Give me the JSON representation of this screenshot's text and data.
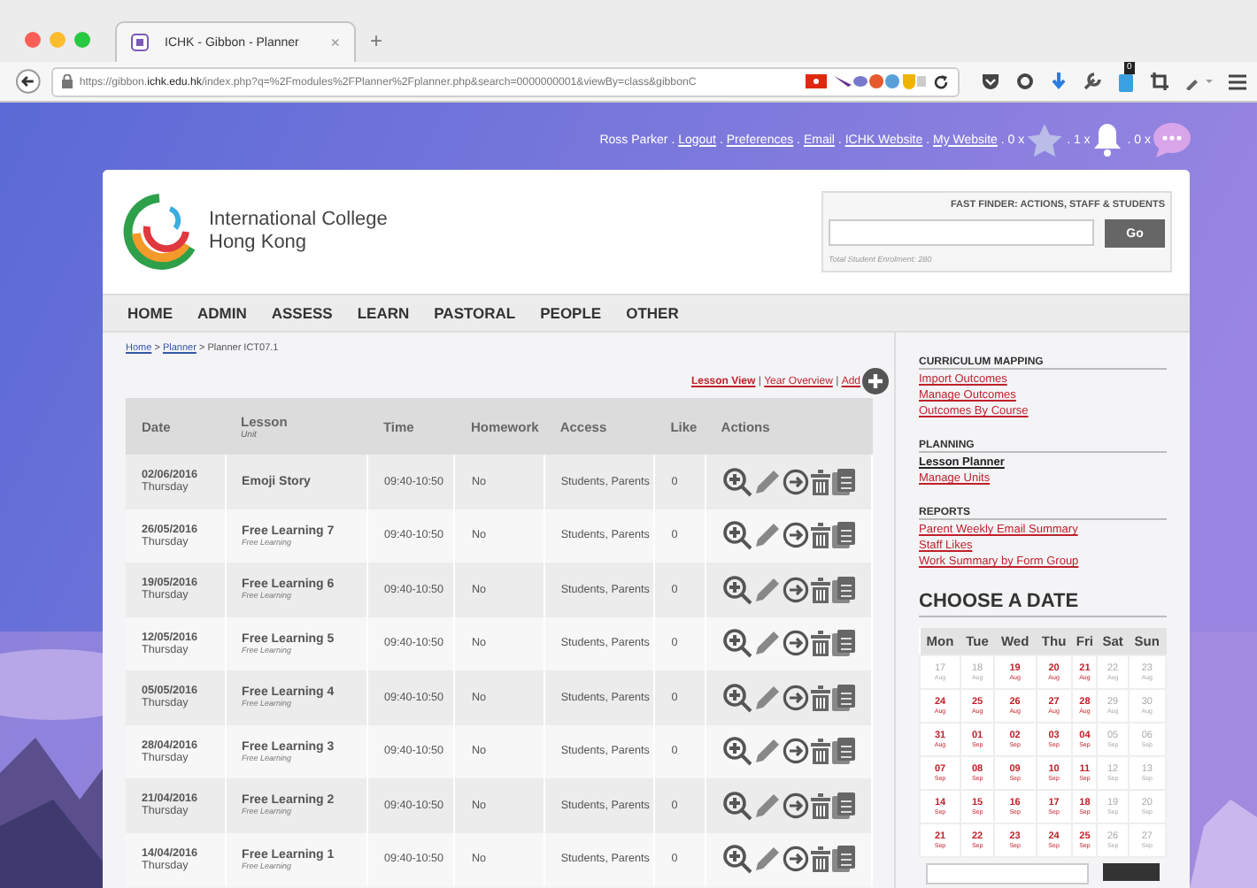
{
  "browser": {
    "tab_title": "ICHK - Gibbon - Planner",
    "tab_close": "×",
    "new_tab": "+",
    "url": "https://gibbon.**ichk.edu.hk**/index.php?q=%2Fmodules%2FPlanner%2Fplanner.php&search=0000000001&viewBy=class&gibbonC",
    "badge": "0"
  },
  "user_bar": [
    {
      "kind": "text",
      "text": "Ross Parker"
    },
    {
      "kind": "text",
      "text": " . "
    },
    {
      "kind": "link",
      "text": "Logout"
    },
    {
      "kind": "text",
      "text": " . "
    },
    {
      "kind": "link",
      "text": "Preferences"
    },
    {
      "kind": "text",
      "text": " . "
    },
    {
      "kind": "link",
      "text": "Email"
    },
    {
      "kind": "text",
      "text": " . "
    },
    {
      "kind": "link",
      "text": "ICHK Website"
    },
    {
      "kind": "text",
      "text": " . "
    },
    {
      "kind": "link",
      "text": "My Website"
    },
    {
      "kind": "text",
      "text": " . 0 x"
    },
    {
      "kind": "star"
    },
    {
      "kind": "text",
      "text": " . 1 x"
    },
    {
      "kind": "bell"
    },
    {
      "kind": "text",
      "text": " . 0 x"
    },
    {
      "kind": "chat"
    }
  ],
  "school": {
    "name_line_1": "International College",
    "name_line_2": "Hong Kong"
  },
  "fast_finder": {
    "title": "FAST FINDER: ACTIONS, STAFF & STUDENTS",
    "button": "Go",
    "note": "Total Student Enrolment: 280"
  },
  "nav": [
    "HOME",
    "ADMIN",
    "ASSESS",
    "LEARN",
    "PASTORAL",
    "PEOPLE",
    "OTHER"
  ],
  "breadcrumb": [
    {
      "kind": "link",
      "text": "Home"
    },
    {
      "kind": "text",
      "text": " > "
    },
    {
      "kind": "link",
      "text": "Planner"
    },
    {
      "kind": "text",
      "text": " > Planner ICT07.1"
    }
  ],
  "view_links": [
    {
      "text": "Lesson View",
      "selected": true
    },
    {
      "text": "Year Overview",
      "selected": false
    },
    {
      "text": "Add",
      "selected": false
    }
  ],
  "view_separator": " | ",
  "table": {
    "columns": [
      {
        "label": "Date"
      },
      {
        "label": "Lesson",
        "sub": "Unit"
      },
      {
        "label": "Time"
      },
      {
        "label": "Homework"
      },
      {
        "label": "Access"
      },
      {
        "label": "Like"
      },
      {
        "label": "Actions"
      }
    ],
    "rows": [
      {
        "date": "02/06/2016",
        "day": "Thursday",
        "lesson": "Emoji Story",
        "time": "09:40-10:50",
        "homework": "No",
        "access": "Students, Parents",
        "like": "0"
      },
      {
        "date": "26/05/2016",
        "day": "Thursday",
        "lesson": "Free Learning 7",
        "unit": "Free Learning",
        "time": "09:40-10:50",
        "homework": "No",
        "access": "Students, Parents",
        "like": "0"
      },
      {
        "date": "19/05/2016",
        "day": "Thursday",
        "lesson": "Free Learning 6",
        "unit": "Free Learning",
        "time": "09:40-10:50",
        "homework": "No",
        "access": "Students, Parents",
        "like": "0"
      },
      {
        "date": "12/05/2016",
        "day": "Thursday",
        "lesson": "Free Learning 5",
        "unit": "Free Learning",
        "time": "09:40-10:50",
        "homework": "No",
        "access": "Students, Parents",
        "like": "0"
      },
      {
        "date": "05/05/2016",
        "day": "Thursday",
        "lesson": "Free Learning 4",
        "unit": "Free Learning",
        "time": "09:40-10:50",
        "homework": "No",
        "access": "Students, Parents",
        "like": "0"
      },
      {
        "date": "28/04/2016",
        "day": "Thursday",
        "lesson": "Free Learning 3",
        "unit": "Free Learning",
        "time": "09:40-10:50",
        "homework": "No",
        "access": "Students, Parents",
        "like": "0"
      },
      {
        "date": "21/04/2016",
        "day": "Thursday",
        "lesson": "Free Learning 2",
        "unit": "Free Learning",
        "time": "09:40-10:50",
        "homework": "No",
        "access": "Students, Parents",
        "like": "0"
      },
      {
        "date": "14/04/2016",
        "day": "Thursday",
        "lesson": "Free Learning 1",
        "unit": "Free Learning",
        "time": "09:40-10:50",
        "homework": "No",
        "access": "Students, Parents",
        "like": "0"
      }
    ]
  },
  "sidebar": [
    {
      "title": "CURRICULUM MAPPING",
      "links": [
        {
          "text": "Import Outcomes",
          "selected": false
        },
        {
          "text": "Manage Outcomes",
          "selected": false
        },
        {
          "text": "Outcomes By Course",
          "selected": false
        }
      ]
    },
    {
      "title": "PLANNING",
      "links": [
        {
          "text": "Lesson Planner",
          "selected": true
        },
        {
          "text": "Manage Units",
          "selected": false
        }
      ]
    },
    {
      "title": "REPORTS",
      "links": [
        {
          "text": "Parent Weekly Email Summary",
          "selected": false
        },
        {
          "text": "Staff Likes",
          "selected": false
        },
        {
          "text": "Work Summary by Form Group",
          "selected": false
        }
      ]
    }
  ],
  "calendar": {
    "title": "CHOOSE A DATE",
    "weekdays": [
      "Mon",
      "Tue",
      "Wed",
      "Thu",
      "Fri",
      "Sat",
      "Sun"
    ],
    "weeks": [
      [
        {
          "day": "17",
          "month": "Aug",
          "active": false
        },
        {
          "day": "18",
          "month": "Aug",
          "active": false
        },
        {
          "day": "19",
          "month": "Aug",
          "active": true
        },
        {
          "day": "20",
          "month": "Aug",
          "active": true
        },
        {
          "day": "21",
          "month": "Aug",
          "active": true
        },
        {
          "day": "22",
          "month": "Aug",
          "active": false
        },
        {
          "day": "23",
          "month": "Aug",
          "active": false
        }
      ],
      [
        {
          "day": "24",
          "month": "Aug",
          "active": true
        },
        {
          "day": "25",
          "month": "Aug",
          "active": true
        },
        {
          "day": "26",
          "month": "Aug",
          "active": true
        },
        {
          "day": "27",
          "month": "Aug",
          "active": true
        },
        {
          "day": "28",
          "month": "Aug",
          "active": true
        },
        {
          "day": "29",
          "month": "Aug",
          "active": false
        },
        {
          "day": "30",
          "month": "Aug",
          "active": false
        }
      ],
      [
        {
          "day": "31",
          "month": "Aug",
          "active": true
        },
        {
          "day": "01",
          "month": "Sep",
          "active": true
        },
        {
          "day": "02",
          "month": "Sep",
          "active": true
        },
        {
          "day": "03",
          "month": "Sep",
          "active": true
        },
        {
          "day": "04",
          "month": "Sep",
          "active": true
        },
        {
          "day": "05",
          "month": "Sep",
          "active": false
        },
        {
          "day": "06",
          "month": "Sep",
          "active": false
        }
      ],
      [
        {
          "day": "07",
          "month": "Sep",
          "active": true
        },
        {
          "day": "08",
          "month": "Sep",
          "active": true
        },
        {
          "day": "09",
          "month": "Sep",
          "active": true
        },
        {
          "day": "10",
          "month": "Sep",
          "active": true
        },
        {
          "day": "11",
          "month": "Sep",
          "active": true
        },
        {
          "day": "12",
          "month": "Sep",
          "active": false
        },
        {
          "day": "13",
          "month": "Sep",
          "active": false
        }
      ],
      [
        {
          "day": "14",
          "month": "Sep",
          "active": true
        },
        {
          "day": "15",
          "month": "Sep",
          "active": true
        },
        {
          "day": "16",
          "month": "Sep",
          "active": true
        },
        {
          "day": "17",
          "month": "Sep",
          "active": true
        },
        {
          "day": "18",
          "month": "Sep",
          "active": true
        },
        {
          "day": "19",
          "month": "Sep",
          "active": false
        },
        {
          "day": "20",
          "month": "Sep",
          "active": false
        }
      ],
      [
        {
          "day": "21",
          "month": "Sep",
          "active": true
        },
        {
          "day": "22",
          "month": "Sep",
          "active": true
        },
        {
          "day": "23",
          "month": "Sep",
          "active": true
        },
        {
          "day": "24",
          "month": "Sep",
          "active": true
        },
        {
          "day": "25",
          "month": "Sep",
          "active": true
        },
        {
          "day": "26",
          "month": "Sep",
          "active": false
        },
        {
          "day": "27",
          "month": "Sep",
          "active": false
        }
      ]
    ]
  }
}
